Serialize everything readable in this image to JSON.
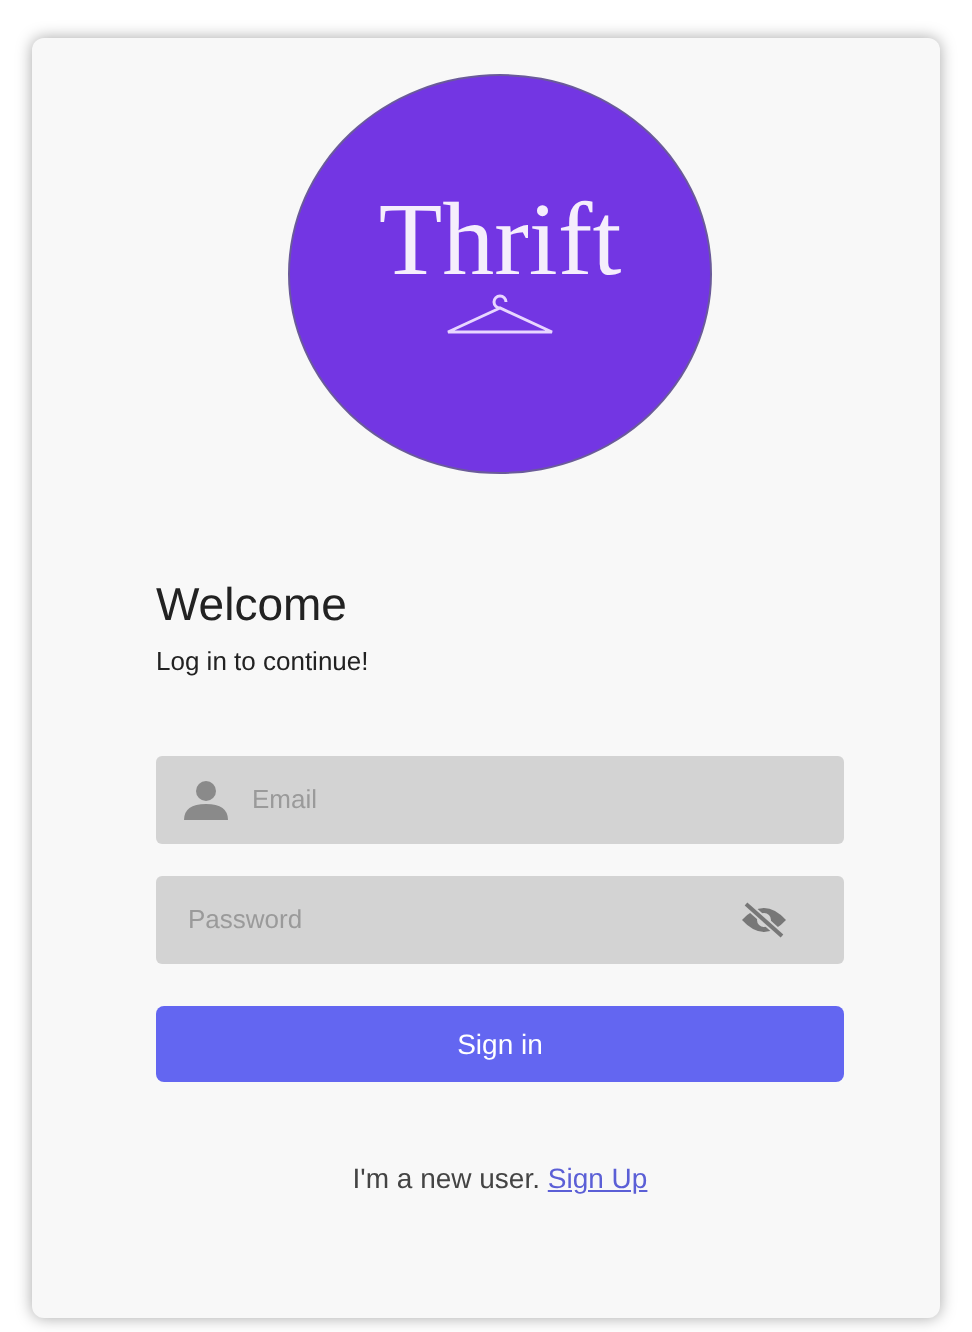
{
  "logo": {
    "text": "Thrift"
  },
  "heading": "Welcome",
  "subheading": "Log in to continue!",
  "fields": [
    {
      "kind": "email",
      "placeholder": "Email"
    },
    {
      "kind": "password",
      "placeholder": "Password",
      "password_visible": false
    }
  ],
  "button": "Sign in",
  "signup": {
    "text": "I'm a new user.",
    "link": "Sign Up"
  }
}
